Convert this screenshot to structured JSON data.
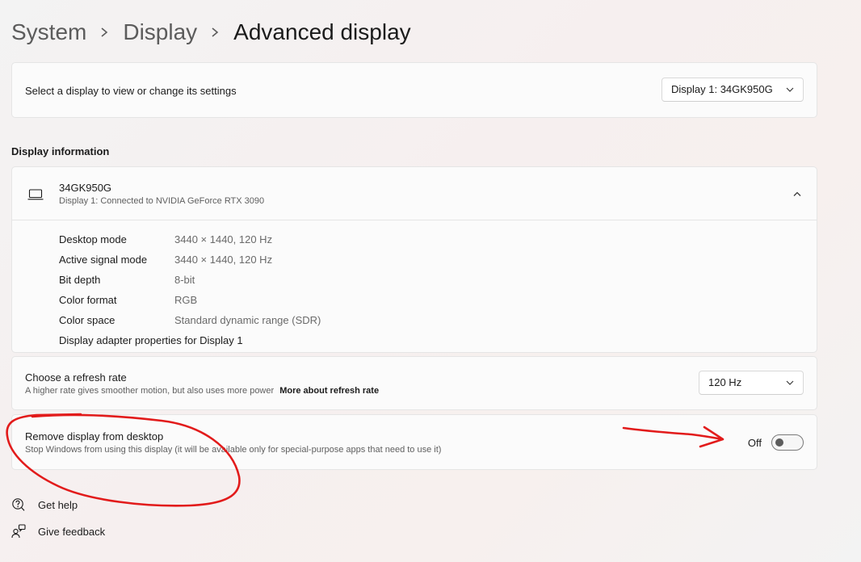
{
  "breadcrumb": {
    "items": [
      "System",
      "Display",
      "Advanced display"
    ]
  },
  "select_display": {
    "label": "Select a display to view or change its settings",
    "dropdown_value": "Display 1: 34GK950G"
  },
  "display_information": {
    "section_title": "Display information",
    "monitor_name": "34GK950G",
    "monitor_subtitle": "Display 1: Connected to NVIDIA GeForce RTX 3090",
    "rows": [
      {
        "label": "Desktop mode",
        "value": "3440 × 1440, 120 Hz"
      },
      {
        "label": "Active signal mode",
        "value": "3440 × 1440, 120 Hz"
      },
      {
        "label": "Bit depth",
        "value": "8-bit"
      },
      {
        "label": "Color format",
        "value": "RGB"
      },
      {
        "label": "Color space",
        "value": "Standard dynamic range (SDR)"
      }
    ],
    "adapter_link": "Display adapter properties for Display 1"
  },
  "refresh_rate": {
    "title": "Choose a refresh rate",
    "description": "A higher rate gives smoother motion, but also uses more power",
    "more_link": "More about refresh rate",
    "dropdown_value": "120 Hz"
  },
  "remove_display": {
    "title": "Remove display from desktop",
    "description": "Stop Windows from using this display (it will be available only for special-purpose apps that need to use it)",
    "toggle_label": "Off",
    "toggle_on": false
  },
  "footer": {
    "get_help": "Get help",
    "give_feedback": "Give feedback"
  },
  "annotation": {
    "color": "#e21b1b"
  }
}
